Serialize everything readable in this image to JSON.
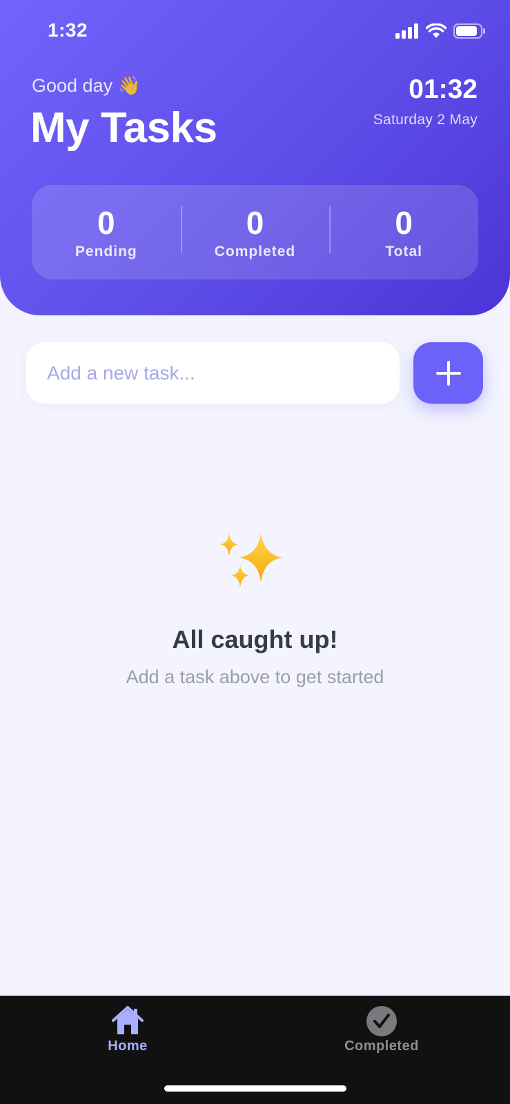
{
  "status_bar": {
    "time": "1:32"
  },
  "header": {
    "greeting": "Good day 👋",
    "title": "My Tasks",
    "clock": "01:32",
    "date": "Saturday 2 May"
  },
  "stats": [
    {
      "value": "0",
      "label": "Pending"
    },
    {
      "value": "0",
      "label": "Completed"
    },
    {
      "value": "0",
      "label": "Total"
    }
  ],
  "new_task": {
    "placeholder": "Add a new task...",
    "value": ""
  },
  "empty_state": {
    "icon": "sparkles-icon",
    "title": "All caught up!",
    "subtitle": "Add a task above to get started"
  },
  "tabs": [
    {
      "label": "Home",
      "icon": "home-icon",
      "active": true
    },
    {
      "label": "Completed",
      "icon": "check-circle-icon",
      "active": false
    }
  ],
  "colors": {
    "accent": "#6c62fa",
    "header_start": "#7163fb",
    "header_end": "#4c34d6",
    "background": "#f3f4fe"
  }
}
